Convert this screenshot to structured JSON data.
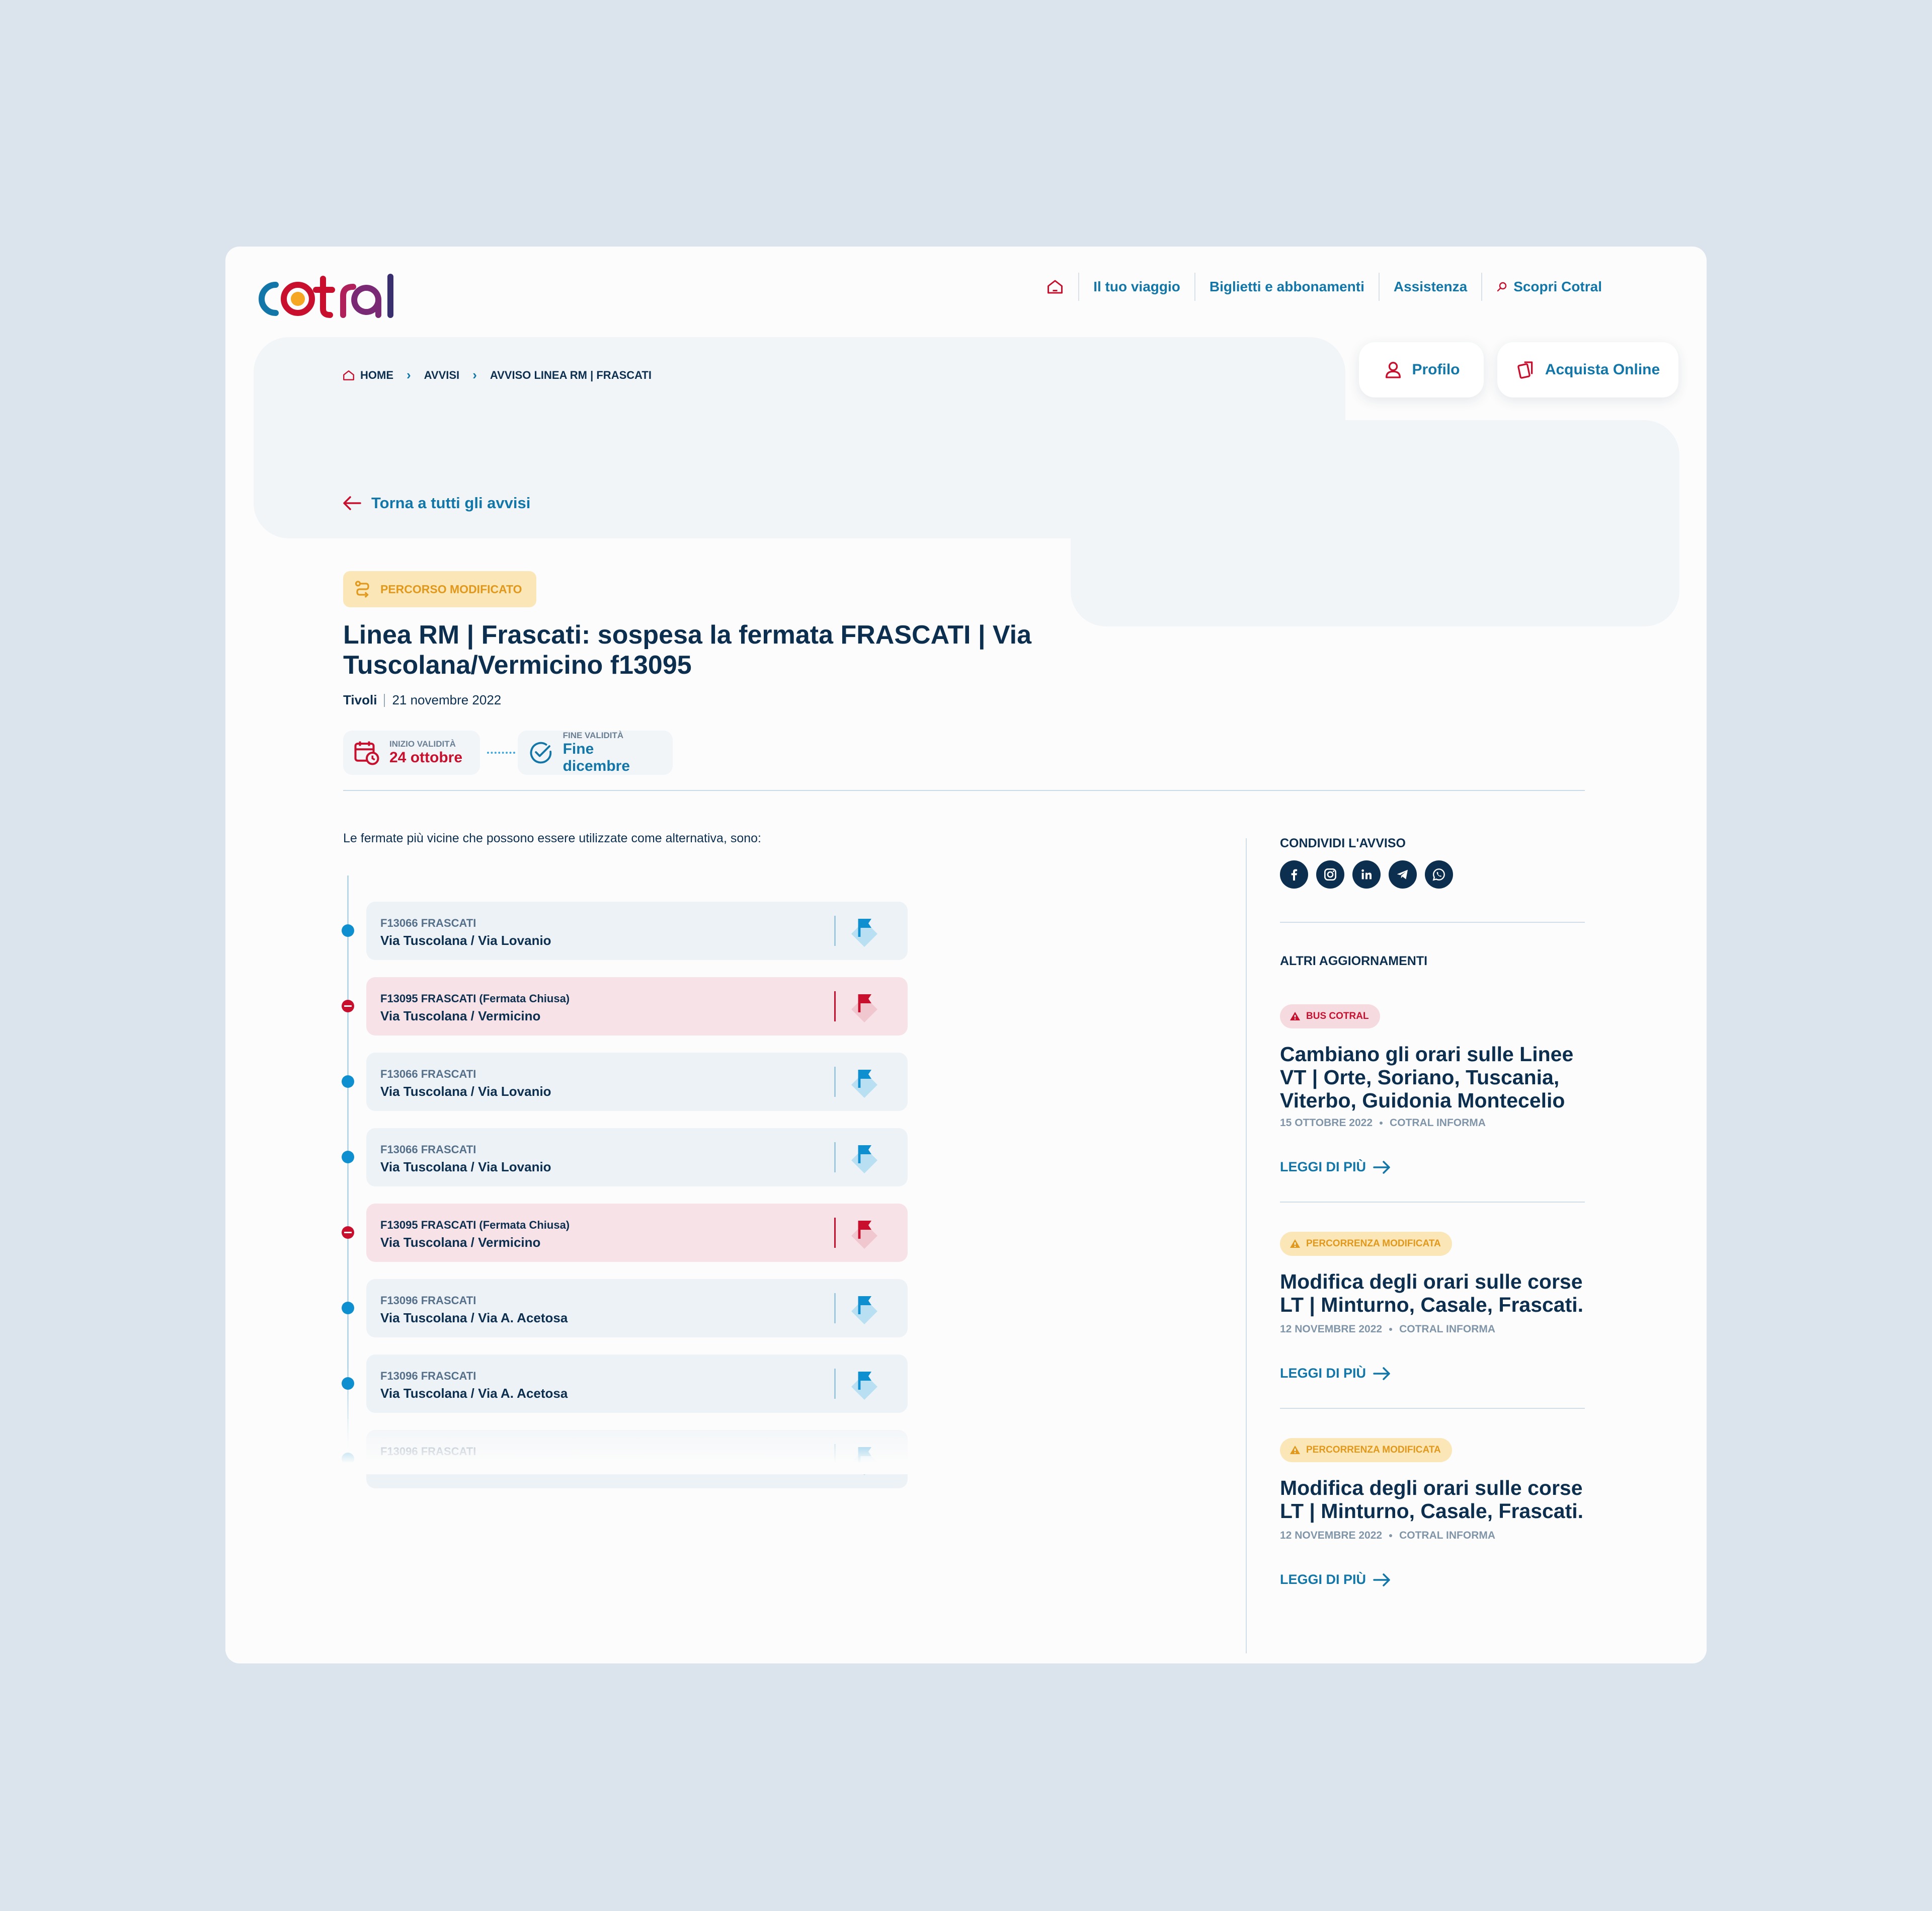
{
  "brand": {
    "logo_text": "cotral",
    "primary": "#0d2f4f",
    "accent_blue": "#1277a8",
    "accent_red": "#c8102e",
    "accent_yellow": "#e2981a"
  },
  "nav": {
    "items": [
      {
        "label": "Il tuo viaggio"
      },
      {
        "label": "Biglietti e abbonamenti"
      },
      {
        "label": "Assistenza"
      },
      {
        "label": "Scopri Cotral"
      }
    ]
  },
  "actions": {
    "profile": "Profilo",
    "buy": "Acquista Online"
  },
  "breadcrumb": [
    "HOME",
    "AVVISI",
    "AVVISO LINEA RM | FRASCATI"
  ],
  "back": "Torna a tutti gli avvisi",
  "notice": {
    "tag": "PERCORSO MODIFICATO",
    "title": "Linea RM | Frascati: sospesa la fermata FRASCATI | Via Tuscolana/Vermicino f13095",
    "place": "Tivoli",
    "date": "21 novembre 2022",
    "start_label": "INIZIO VALIDITÀ",
    "start_value": "24 ottobre",
    "end_label": "FINE VALIDITÀ",
    "end_value": "Fine dicembre",
    "intro": "Le fermate più vicine che possono essere utilizzate come alternativa, sono:"
  },
  "stops": [
    {
      "code": "F13066 FRASCATI",
      "name": "Via Tuscolana / Via Lovanio",
      "closed": false
    },
    {
      "code": "F13095 FRASCATI (Fermata Chiusa)",
      "name": "Via Tuscolana / Vermicino",
      "closed": true
    },
    {
      "code": "F13066 FRASCATI",
      "name": "Via Tuscolana / Via Lovanio",
      "closed": false
    },
    {
      "code": "F13066 FRASCATI",
      "name": "Via Tuscolana / Via Lovanio",
      "closed": false
    },
    {
      "code": "F13095 FRASCATI (Fermata Chiusa)",
      "name": "Via Tuscolana / Vermicino",
      "closed": true
    },
    {
      "code": "F13096 FRASCATI",
      "name": "Via Tuscolana / Via A. Acetosa",
      "closed": false
    },
    {
      "code": "F13096 FRASCATI",
      "name": "Via Tuscolana / Via A. Acetosa",
      "closed": false
    },
    {
      "code": "F13096 FRASCATI",
      "name": "",
      "closed": false
    }
  ],
  "share": {
    "heading": "CONDIVIDI L'AVVISO",
    "icons": [
      "facebook-icon",
      "instagram-icon",
      "linkedin-icon",
      "telegram-icon",
      "whatsapp-icon"
    ]
  },
  "updates": {
    "heading": "ALTRI AGGIORNAMENTI",
    "items": [
      {
        "badge": "BUS COTRAL",
        "title": "Cambiano gli orari sulle Linee VT | Orte, Soriano, Tuscania, Viterbo, Guidonia Montecelio",
        "date": "15 OTTOBRE 2022",
        "source": "COTRAL INFORMA",
        "more": "LEGGI DI PIÙ"
      },
      {
        "badge": "PERCORRENZA MODIFICATA",
        "title": "Modifica degli orari sulle corse LT | Minturno, Casale, Frascati.",
        "date": "12 NOVEMBRE 2022",
        "source": "COTRAL INFORMA",
        "more": "LEGGI DI PIÙ"
      },
      {
        "badge": "PERCORRENZA MODIFICATA",
        "title": "Modifica degli orari sulle corse LT | Minturno, Casale, Frascati.",
        "date": "12 NOVEMBRE 2022",
        "source": "COTRAL INFORMA",
        "more": "LEGGI DI PIÙ"
      }
    ]
  }
}
